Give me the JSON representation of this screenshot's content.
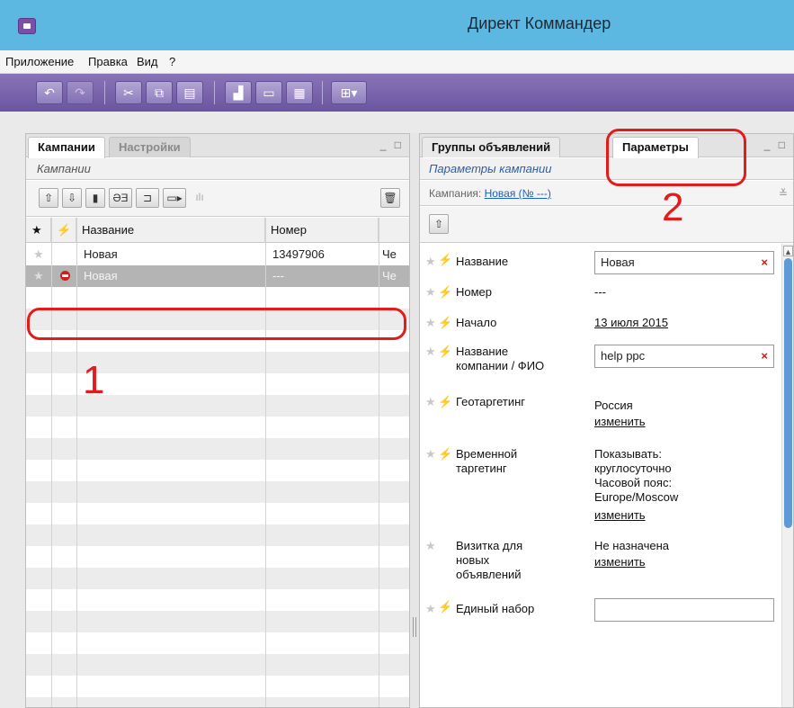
{
  "window": {
    "title": "Директ Коммандер"
  },
  "menu": [
    "Приложение",
    "Правка",
    "Вид",
    "?"
  ],
  "toolbar": {
    "buttons": [
      {
        "name": "undo-icon",
        "glyph": "↶"
      },
      {
        "name": "redo-icon",
        "glyph": "↷"
      },
      {
        "name": "cut-icon",
        "glyph": "✂"
      },
      {
        "name": "copy-icon",
        "glyph": "⧉"
      },
      {
        "name": "paste-icon",
        "glyph": "▤"
      },
      {
        "name": "stats-icon",
        "glyph": "▟"
      },
      {
        "name": "banner-icon",
        "glyph": "▭"
      },
      {
        "name": "table-icon",
        "glyph": "▦"
      },
      {
        "name": "layout-dropdown-icon",
        "glyph": "⊞▾"
      }
    ]
  },
  "left_panel": {
    "tabs": [
      "Кампании",
      "Настройки"
    ],
    "window_controls": "_ □",
    "subtitle": "Кампании",
    "toolbar_glyphs": {
      "upload": "⇧",
      "download": "⇩",
      "new": "▮",
      "rename": "ƏƎ",
      "import": "⊐",
      "export": "▭▸",
      "stats": "ılı",
      "delete": "🗑"
    },
    "columns": {
      "star": "★",
      "bolt": "⚡",
      "name": "Название",
      "number": "Номер"
    },
    "rows": [
      {
        "star": "★",
        "name": "Новая",
        "number": "13497906",
        "extra": "Че"
      },
      {
        "star": "★",
        "name": "Новая",
        "number": "---",
        "extra": "Че"
      }
    ],
    "annotation": "1"
  },
  "right_panel": {
    "tabs": [
      "Группы объявлений",
      "Параметры"
    ],
    "window_controls": "_ □",
    "subtitle": "Параметры кампании",
    "campaign_label": "Кампания:",
    "campaign_link": "Новая (№ ---)",
    "annotation": "2",
    "params": {
      "name": {
        "label": "Название",
        "value": "Новая"
      },
      "number": {
        "label": "Номер",
        "value": "---"
      },
      "start": {
        "label": "Начало",
        "value": "13 июля 2015"
      },
      "company": {
        "label_1": "Название",
        "label_2": "компании / ФИО",
        "value": "help ppc"
      },
      "geo": {
        "label": "Геотаргетинг",
        "value": "Россия",
        "link": "изменить"
      },
      "time": {
        "label_1": "Временной",
        "label_2": "таргетинг",
        "lines": [
          "Показывать:",
          "круглосуточно",
          "Часовой пояс:",
          "Europe/Moscow"
        ],
        "link": "изменить"
      },
      "vcard": {
        "label_1": "Визитка для",
        "label_2": "новых",
        "label_3": "объявлений",
        "value": "Не назначена",
        "link": "изменить"
      },
      "single_set": {
        "label": "Единый набор"
      }
    }
  }
}
